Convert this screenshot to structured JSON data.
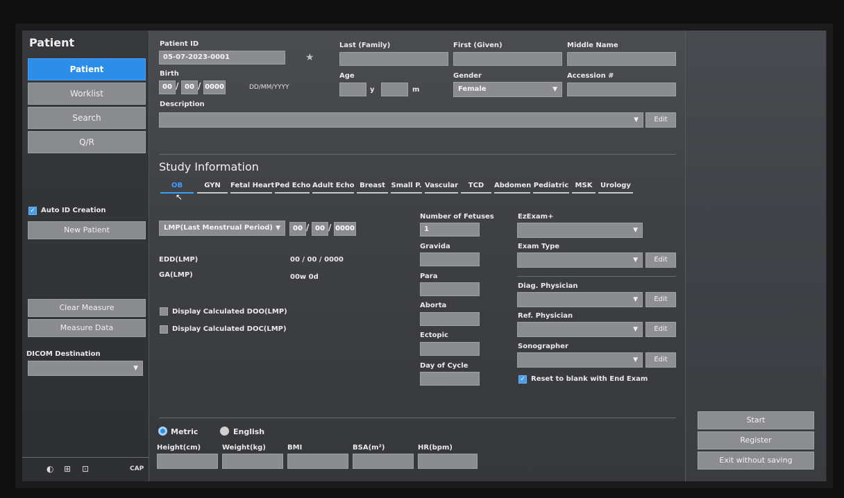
{
  "sidebar": {
    "title": "Patient",
    "buttons": [
      "Patient",
      "Worklist",
      "Search",
      "Q/R"
    ],
    "auto_id_label": "Auto ID Creation",
    "new_patient": "New Patient",
    "clear_measure": "Clear Measure",
    "measure_data": "Measure Data",
    "dicom_label": "DICOM Destination",
    "dicom_value": "",
    "footer_cap": "CAP"
  },
  "patient": {
    "id_label": "Patient ID",
    "id_value": "05-07-2023-0001",
    "last_label": "Last (Family)",
    "last_value": "",
    "first_label": "First (Given)",
    "first_value": "",
    "middle_label": "Middle Name",
    "middle_value": "",
    "birth_label": "Birth",
    "birth_dd": "00",
    "birth_mm": "00",
    "birth_yyyy": "0000",
    "birth_format": "DD/MM/YYYY",
    "age_label": "Age",
    "age_y_unit": "y",
    "age_m_unit": "m",
    "gender_label": "Gender",
    "gender_value": "Female",
    "accession_label": "Accession #",
    "accession_value": "",
    "description_label": "Description",
    "description_value": "",
    "edit": "Edit"
  },
  "study": {
    "title": "Study Information",
    "tabs": [
      "OB",
      "GYN",
      "Fetal Heart",
      "Ped Echo",
      "Adult Echo",
      "Breast",
      "Small P.",
      "Vascular",
      "TCD",
      "Abdomen",
      "Pediatric",
      "MSK",
      "Urology"
    ],
    "active_tab": "OB",
    "lmp_select": "LMP(Last Menstrual Period)",
    "lmp_dd": "00",
    "lmp_mm": "00",
    "lmp_yyyy": "0000",
    "edd_label": "EDD(LMP)",
    "edd_value": "00 / 00 / 0000",
    "ga_label": "GA(LMP)",
    "ga_value": "00w 0d",
    "display_doo": "Display Calculated DOO(LMP)",
    "display_doc": "Display Calculated DOC(LMP)",
    "num_fetuses_label": "Number of Fetuses",
    "num_fetuses_value": "1",
    "gravida_label": "Gravida",
    "para_label": "Para",
    "aborta_label": "Aborta",
    "ectopic_label": "Ectopic",
    "day_of_cycle_label": "Day of Cycle",
    "ezexam_label": "EzExam+",
    "exam_type_label": "Exam Type",
    "diag_physician_label": "Diag. Physician",
    "ref_physician_label": "Ref. Physician",
    "sonographer_label": "Sonographer",
    "reset_label": "Reset to blank with End Exam"
  },
  "measure": {
    "metric": "Metric",
    "english": "English",
    "height_label": "Height(cm)",
    "weight_label": "Weight(kg)",
    "bmi_label": "BMI",
    "bsa_label": "BSA(m²)",
    "hr_label": "HR(bpm)"
  },
  "actions": {
    "start": "Start",
    "register": "Register",
    "exit": "Exit without saving"
  },
  "colors": {
    "accent": "#2c8ee8",
    "field": "#8b8c8f",
    "background": "#3f4145"
  }
}
